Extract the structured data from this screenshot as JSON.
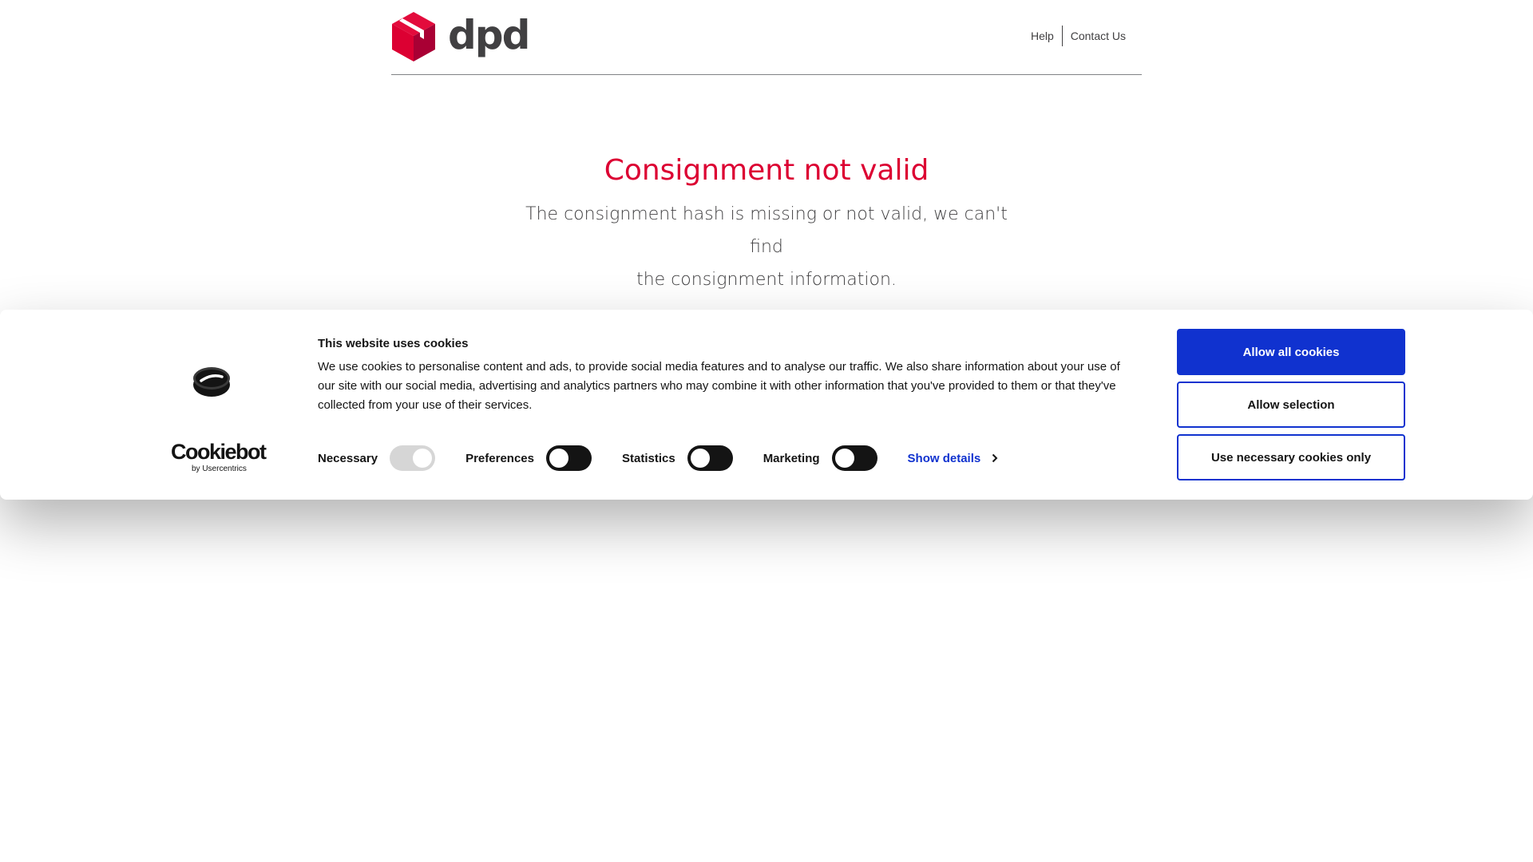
{
  "header": {
    "brand": "dpd",
    "nav": [
      {
        "label": "Help"
      },
      {
        "label": "Contact Us"
      }
    ]
  },
  "error": {
    "title": "Consignment not valid",
    "message_line1": "The consignment hash is missing or not valid, we can't find",
    "message_line2": "the consignment information."
  },
  "cookie_banner": {
    "logo_text": "Cookiebot",
    "logo_subtext": "by Usercentrics",
    "title": "This website uses cookies",
    "text": "We use cookies to personalise content and ads, to provide social media features and to analyse our traffic. We also share information about your use of our site with our social media, advertising and analytics partners who may combine it with other information that you've provided to them or that they've collected from your use of their services.",
    "toggles": [
      {
        "label": "Necessary",
        "checked": true,
        "disabled": true
      },
      {
        "label": "Preferences",
        "checked": false,
        "disabled": false
      },
      {
        "label": "Statistics",
        "checked": false,
        "disabled": false
      },
      {
        "label": "Marketing",
        "checked": false,
        "disabled": false
      }
    ],
    "show_details": "Show details",
    "buttons": {
      "allow_all": "Allow all cookies",
      "allow_selection": "Allow selection",
      "necessary_only": "Use necessary cookies only"
    }
  },
  "colors": {
    "brand_red": "#dc0032",
    "cookiebot_blue": "#1032cf",
    "text_dark": "#414042"
  }
}
